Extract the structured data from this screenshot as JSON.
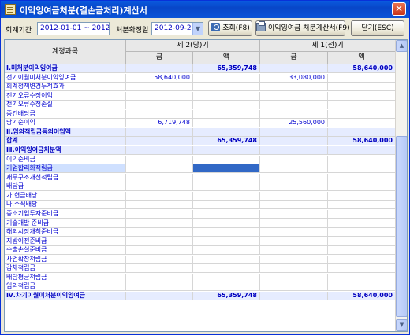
{
  "window": {
    "title": "이익잉여금처분(결손금처리)계산서",
    "close_label": "✕"
  },
  "toolbar": {
    "period_label": "회계기간",
    "period_value": "2012-01-01 ~ 2012-12-31",
    "date_label": "처분확정일",
    "date_value": "2012-09-29",
    "dropdown_glyph": "▼",
    "search_button": "조회(F8)",
    "print_button": "이익잉여금 처분계산서(F9)",
    "close_button": "닫기(ESC)"
  },
  "grid": {
    "header": {
      "account_col": "계정과목",
      "current_period": "제 2(당)기",
      "prior_period": "제 1(전)기",
      "amount_a": "금",
      "amount_b": "액"
    },
    "rows": [
      {
        "name": "Ⅰ.미처분이익잉여금",
        "type": "section",
        "c1": "",
        "c2": "65,359,748",
        "p1": "",
        "p2": "58,640,000"
      },
      {
        "name": "  전기이월미처분이익잉여금",
        "type": "item",
        "c1": "58,640,000",
        "c2": "",
        "p1": "33,080,000",
        "p2": ""
      },
      {
        "name": "  회계정책변경누적효과",
        "type": "item",
        "c1": "",
        "c2": "",
        "p1": "",
        "p2": ""
      },
      {
        "name": "  전기오류수정이익",
        "type": "item",
        "c1": "",
        "c2": "",
        "p1": "",
        "p2": ""
      },
      {
        "name": "  전기오류수정손실",
        "type": "item",
        "c1": "",
        "c2": "",
        "p1": "",
        "p2": ""
      },
      {
        "name": "  중간배당금",
        "type": "item",
        "c1": "",
        "c2": "",
        "p1": "",
        "p2": ""
      },
      {
        "name": "  당기순이익",
        "type": "item",
        "c1": "6,719,748",
        "c2": "",
        "p1": "25,560,000",
        "p2": ""
      },
      {
        "name": "Ⅱ.임의적립금등의이입액",
        "type": "section",
        "c1": "",
        "c2": "",
        "p1": "",
        "p2": ""
      },
      {
        "name": "합계",
        "type": "total",
        "c1": "",
        "c2": "65,359,748",
        "p1": "",
        "p2": "58,640,000"
      },
      {
        "name": "Ⅲ.이익잉여금처분액",
        "type": "section",
        "c1": "",
        "c2": "",
        "p1": "",
        "p2": ""
      },
      {
        "name": "  이익준비금",
        "type": "item",
        "c1": "",
        "c2": "",
        "p1": "",
        "p2": ""
      },
      {
        "name": "  기업합리화적립금",
        "type": "selected",
        "c1": "",
        "c2": "",
        "p1": "",
        "p2": ""
      },
      {
        "name": "  재무구조개선적립금",
        "type": "item",
        "c1": "",
        "c2": "",
        "p1": "",
        "p2": ""
      },
      {
        "name": "  배당금",
        "type": "item",
        "c1": "",
        "c2": "",
        "p1": "",
        "p2": ""
      },
      {
        "name": "    가.현금배당",
        "type": "item",
        "c1": "",
        "c2": "",
        "p1": "",
        "p2": ""
      },
      {
        "name": "    나.주식배당",
        "type": "item",
        "c1": "",
        "c2": "",
        "p1": "",
        "p2": ""
      },
      {
        "name": "  중소기업투자준비금",
        "type": "item",
        "c1": "",
        "c2": "",
        "p1": "",
        "p2": ""
      },
      {
        "name": "  기술개발 준비금",
        "type": "item",
        "c1": "",
        "c2": "",
        "p1": "",
        "p2": ""
      },
      {
        "name": "  해외시장개척준비금",
        "type": "item",
        "c1": "",
        "c2": "",
        "p1": "",
        "p2": ""
      },
      {
        "name": "  지방이전준비금",
        "type": "item",
        "c1": "",
        "c2": "",
        "p1": "",
        "p2": ""
      },
      {
        "name": "  수출손실준비금",
        "type": "item",
        "c1": "",
        "c2": "",
        "p1": "",
        "p2": ""
      },
      {
        "name": "  사업확장적립금",
        "type": "item",
        "c1": "",
        "c2": "",
        "p1": "",
        "p2": ""
      },
      {
        "name": "  감채적립금",
        "type": "item",
        "c1": "",
        "c2": "",
        "p1": "",
        "p2": ""
      },
      {
        "name": "  배당평균적립금",
        "type": "item",
        "c1": "",
        "c2": "",
        "p1": "",
        "p2": ""
      },
      {
        "name": "  임의적립금",
        "type": "item",
        "c1": "",
        "c2": "",
        "p1": "",
        "p2": ""
      },
      {
        "name": "Ⅳ.차기이월미처분이익잉여금",
        "type": "section",
        "c1": "",
        "c2": "65,359,748",
        "p1": "",
        "p2": "58,640,000"
      }
    ]
  },
  "scrollbar": {
    "up_glyph": "▲",
    "down_glyph": "▼"
  }
}
